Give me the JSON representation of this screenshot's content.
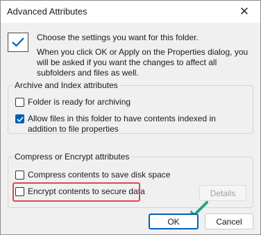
{
  "window": {
    "title": "Advanced Attributes"
  },
  "intro": {
    "heading": "Choose the settings you want for this folder.",
    "body": "When you click OK or Apply on the Properties dialog, you will be asked if you want the changes to affect all subfolders and files as well."
  },
  "archive_group": {
    "label": "Archive and Index attributes",
    "items": [
      {
        "label": "Folder is ready for archiving",
        "checked": false
      },
      {
        "label": "Allow files in this folder to have contents indexed in addition to file properties",
        "checked": true
      }
    ]
  },
  "compress_group": {
    "label": "Compress or Encrypt attributes",
    "items": [
      {
        "label": "Compress contents to save disk space",
        "checked": false
      },
      {
        "label": "Encrypt contents to secure data",
        "checked": false
      }
    ],
    "details_label": "Details"
  },
  "buttons": {
    "ok": "OK",
    "cancel": "Cancel"
  },
  "colors": {
    "accent": "#005fb8",
    "highlight": "#e14848",
    "arrow": "#1fa67e"
  }
}
